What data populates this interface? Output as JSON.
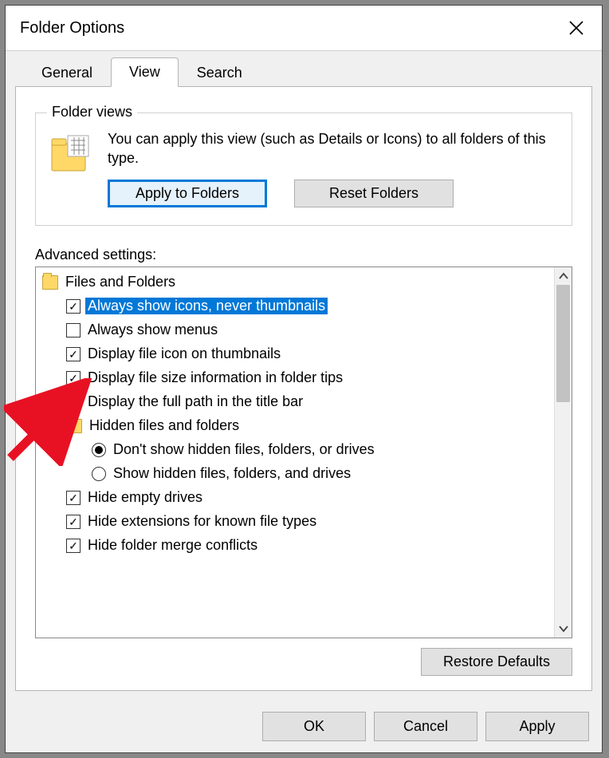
{
  "window": {
    "title": "Folder Options"
  },
  "tabs": {
    "general": "General",
    "view": "View",
    "search": "Search",
    "active": "view"
  },
  "folder_views": {
    "legend": "Folder views",
    "description": "You can apply this view (such as Details or Icons) to all folders of this type.",
    "apply_btn": "Apply to Folders",
    "reset_btn": "Reset Folders"
  },
  "advanced": {
    "label": "Advanced settings:",
    "root": "Files and Folders",
    "items": [
      {
        "type": "checkbox",
        "checked": true,
        "label": "Always show icons, never thumbnails",
        "selected": true
      },
      {
        "type": "checkbox",
        "checked": false,
        "label": "Always show menus"
      },
      {
        "type": "checkbox",
        "checked": true,
        "label": "Display file icon on thumbnails"
      },
      {
        "type": "checkbox",
        "checked": true,
        "label": "Display file size information in folder tips"
      },
      {
        "type": "checkbox",
        "checked": false,
        "label": "Display the full path in the title bar"
      },
      {
        "type": "folder",
        "label": "Hidden files and folders"
      },
      {
        "type": "radio",
        "checked": true,
        "label": "Don't show hidden files, folders, or drives",
        "indent": 2
      },
      {
        "type": "radio",
        "checked": false,
        "label": "Show hidden files, folders, and drives",
        "indent": 2
      },
      {
        "type": "checkbox",
        "checked": true,
        "label": "Hide empty drives"
      },
      {
        "type": "checkbox",
        "checked": true,
        "label": "Hide extensions for known file types"
      },
      {
        "type": "checkbox",
        "checked": true,
        "label": "Hide folder merge conflicts"
      }
    ],
    "restore_btn": "Restore Defaults"
  },
  "dialog_buttons": {
    "ok": "OK",
    "cancel": "Cancel",
    "apply": "Apply"
  }
}
